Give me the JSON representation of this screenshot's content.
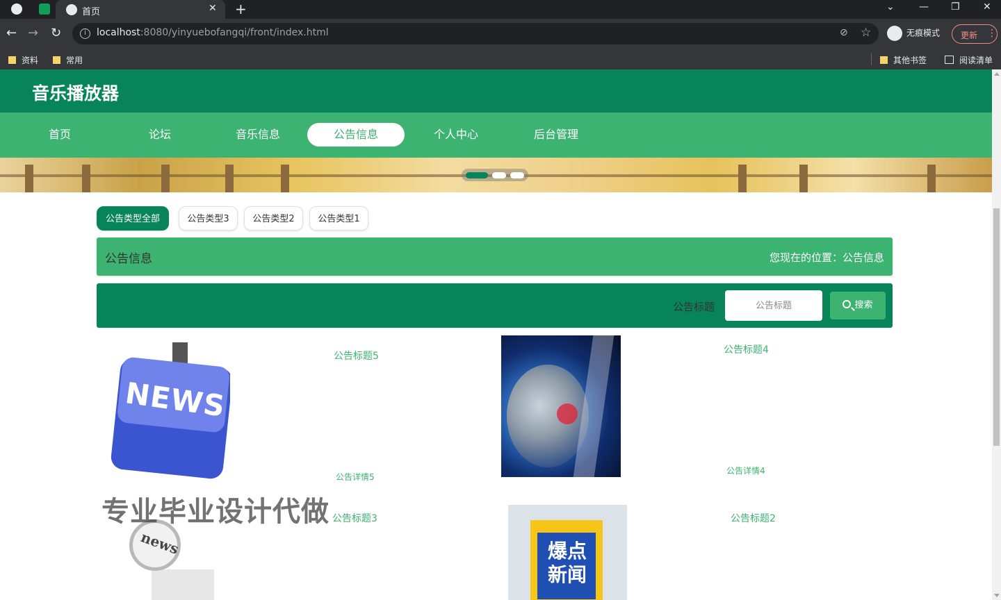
{
  "browser": {
    "tab_title": "首页",
    "url_host": "localhost",
    "url_path": ":8080/yinyuebofangqi/front/index.html",
    "incognito_label": "无痕模式",
    "update_label": "更新",
    "bookmarks": [
      "资料",
      "常用"
    ],
    "other_bookmarks": "其他书签",
    "reading_list": "阅读清单"
  },
  "site": {
    "title": "音乐播放器",
    "nav": [
      {
        "label": "首页",
        "active": false
      },
      {
        "label": "论坛",
        "active": false
      },
      {
        "label": "音乐信息",
        "active": false
      },
      {
        "label": "公告信息",
        "active": true
      },
      {
        "label": "个人中心",
        "active": false
      },
      {
        "label": "后台管理",
        "active": false
      }
    ],
    "carousel": {
      "slides": 3,
      "active_index": 0
    }
  },
  "filters": [
    {
      "label": "公告类型全部",
      "active": true
    },
    {
      "label": "公告类型3",
      "active": false
    },
    {
      "label": "公告类型2",
      "active": false
    },
    {
      "label": "公告类型1",
      "active": false
    }
  ],
  "section": {
    "title": "公告信息",
    "location": "您现在的位置：公告信息"
  },
  "search": {
    "label": "公告标题",
    "placeholder": "公告标题",
    "button_label": "搜索"
  },
  "notices": [
    {
      "title": "公告标题5",
      "detail": "公告详情5",
      "image": "news-keyboard-image"
    },
    {
      "title": "公告标题4",
      "detail": "公告详情4",
      "image": "globe-news-image"
    },
    {
      "title": "公告标题3",
      "image": "magnifier-news-image"
    },
    {
      "title": "公告标题2",
      "image": "baodian-news-image",
      "image_text": "爆点新闻"
    }
  ],
  "thumbnail_text": {
    "news": "NEWS",
    "news_lens": "news"
  },
  "watermark": "专业毕业设计代做",
  "colors": {
    "primary_dark": "#08845a",
    "primary": "#3cb371"
  }
}
